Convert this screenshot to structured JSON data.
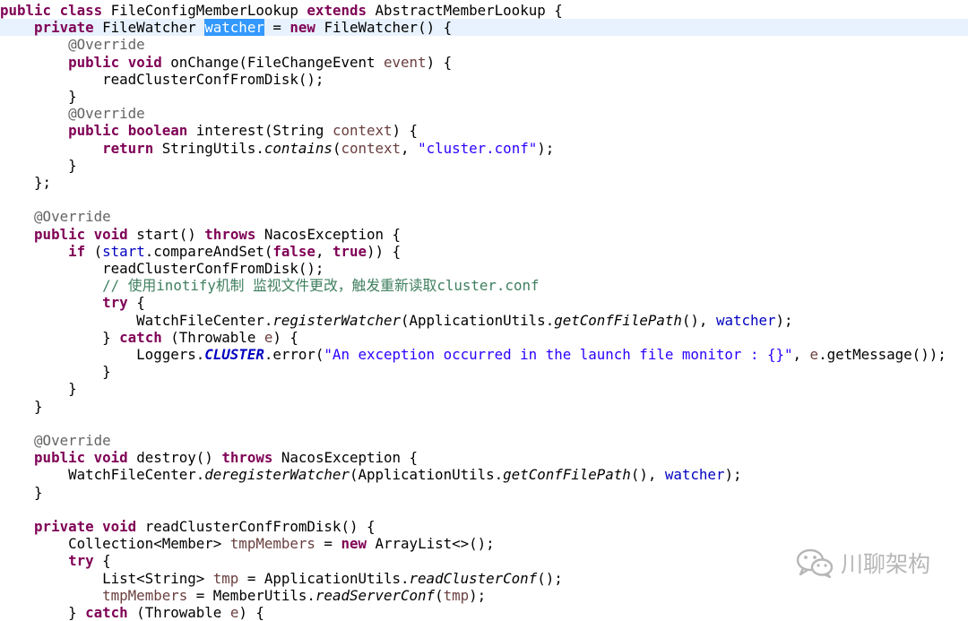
{
  "editor": {
    "lines": [
      [
        {
          "t": "public",
          "c": "kw"
        },
        {
          "t": " "
        },
        {
          "t": "class",
          "c": "kw"
        },
        {
          "t": " FileConfigMemberLookup "
        },
        {
          "t": "extends",
          "c": "kw"
        },
        {
          "t": " AbstractMemberLookup {"
        }
      ],
      [
        {
          "t": "    "
        },
        {
          "t": "private",
          "c": "kw"
        },
        {
          "t": " FileWatcher "
        },
        {
          "t": "watcher",
          "c": "sel"
        },
        {
          "t": " = "
        },
        {
          "t": "new",
          "c": "kw"
        },
        {
          "t": " FileWatcher() {"
        }
      ],
      [
        {
          "t": "        "
        },
        {
          "t": "@Override",
          "c": "ann"
        }
      ],
      [
        {
          "t": "        "
        },
        {
          "t": "public",
          "c": "kw"
        },
        {
          "t": " "
        },
        {
          "t": "void",
          "c": "kw"
        },
        {
          "t": " onChange(FileChangeEvent "
        },
        {
          "t": "event",
          "c": "var"
        },
        {
          "t": ") {"
        }
      ],
      [
        {
          "t": "            readClusterConfFromDisk();"
        }
      ],
      [
        {
          "t": "        }"
        }
      ],
      [
        {
          "t": "        "
        },
        {
          "t": "@Override",
          "c": "ann"
        }
      ],
      [
        {
          "t": "        "
        },
        {
          "t": "public",
          "c": "kw"
        },
        {
          "t": " "
        },
        {
          "t": "boolean",
          "c": "kw"
        },
        {
          "t": " interest(String "
        },
        {
          "t": "context",
          "c": "var"
        },
        {
          "t": ") {"
        }
      ],
      [
        {
          "t": "            "
        },
        {
          "t": "return",
          "c": "kw"
        },
        {
          "t": " StringUtils."
        },
        {
          "t": "contains",
          "c": "ital"
        },
        {
          "t": "("
        },
        {
          "t": "context",
          "c": "var"
        },
        {
          "t": ", "
        },
        {
          "t": "\"cluster.conf\"",
          "c": "str"
        },
        {
          "t": ");"
        }
      ],
      [
        {
          "t": "        }"
        }
      ],
      [
        {
          "t": "    };"
        }
      ],
      [],
      [
        {
          "t": "    "
        },
        {
          "t": "@Override",
          "c": "ann"
        }
      ],
      [
        {
          "t": "    "
        },
        {
          "t": "public",
          "c": "kw"
        },
        {
          "t": " "
        },
        {
          "t": "void",
          "c": "kw"
        },
        {
          "t": " start() "
        },
        {
          "t": "throws",
          "c": "kw"
        },
        {
          "t": " NacosException {"
        }
      ],
      [
        {
          "t": "        "
        },
        {
          "t": "if",
          "c": "kw"
        },
        {
          "t": " ("
        },
        {
          "t": "start",
          "c": "fld"
        },
        {
          "t": ".compareAndSet("
        },
        {
          "t": "false",
          "c": "kw"
        },
        {
          "t": ", "
        },
        {
          "t": "true",
          "c": "kw"
        },
        {
          "t": ")) {"
        }
      ],
      [
        {
          "t": "            readClusterConfFromDisk();"
        }
      ],
      [
        {
          "t": "            "
        },
        {
          "t": "// ",
          "c": "cmt"
        },
        {
          "t": "使用",
          "c": "cmt cjk"
        },
        {
          "t": "inotify",
          "c": "cmt sq"
        },
        {
          "t": "机制 监视文件更改，触发重新读取",
          "c": "cmt cjk"
        },
        {
          "t": "cluster.conf",
          "c": "cmt"
        }
      ],
      [
        {
          "t": "            "
        },
        {
          "t": "try",
          "c": "kw"
        },
        {
          "t": " {"
        }
      ],
      [
        {
          "t": "                WatchFileCenter."
        },
        {
          "t": "registerWatcher",
          "c": "ital"
        },
        {
          "t": "(ApplicationUtils."
        },
        {
          "t": "getConfFilePath",
          "c": "ital"
        },
        {
          "t": "(), "
        },
        {
          "t": "watcher",
          "c": "fld"
        },
        {
          "t": ");"
        }
      ],
      [
        {
          "t": "            } "
        },
        {
          "t": "catch",
          "c": "kw"
        },
        {
          "t": " (Throwable "
        },
        {
          "t": "e",
          "c": "var"
        },
        {
          "t": ") {"
        }
      ],
      [
        {
          "t": "                Loggers."
        },
        {
          "t": "CLUSTER",
          "c": "sfld"
        },
        {
          "t": ".error("
        },
        {
          "t": "\"An exception occurred in the launch file monitor : {}\"",
          "c": "str"
        },
        {
          "t": ", "
        },
        {
          "t": "e",
          "c": "var"
        },
        {
          "t": ".getMessage());"
        }
      ],
      [
        {
          "t": "            }"
        }
      ],
      [
        {
          "t": "        }"
        }
      ],
      [
        {
          "t": "    }"
        }
      ],
      [],
      [
        {
          "t": "    "
        },
        {
          "t": "@Override",
          "c": "ann"
        }
      ],
      [
        {
          "t": "    "
        },
        {
          "t": "public",
          "c": "kw"
        },
        {
          "t": " "
        },
        {
          "t": "void",
          "c": "kw"
        },
        {
          "t": " destroy() "
        },
        {
          "t": "throws",
          "c": "kw"
        },
        {
          "t": " NacosException {"
        }
      ],
      [
        {
          "t": "        WatchFileCenter."
        },
        {
          "t": "deregisterWatcher",
          "c": "ital"
        },
        {
          "t": "(ApplicationUtils."
        },
        {
          "t": "getConfFilePath",
          "c": "ital"
        },
        {
          "t": "(), "
        },
        {
          "t": "watcher",
          "c": "fld"
        },
        {
          "t": ");"
        }
      ],
      [
        {
          "t": "    }"
        }
      ],
      [],
      [
        {
          "t": "    "
        },
        {
          "t": "private",
          "c": "kw"
        },
        {
          "t": " "
        },
        {
          "t": "void",
          "c": "kw"
        },
        {
          "t": " readClusterConfFromDisk() {"
        }
      ],
      [
        {
          "t": "        Collection<Member> "
        },
        {
          "t": "tmpMembers",
          "c": "var"
        },
        {
          "t": " = "
        },
        {
          "t": "new",
          "c": "kw"
        },
        {
          "t": " ArrayList<>();"
        }
      ],
      [
        {
          "t": "        "
        },
        {
          "t": "try",
          "c": "kw"
        },
        {
          "t": " {"
        }
      ],
      [
        {
          "t": "            List<String> "
        },
        {
          "t": "tmp",
          "c": "var"
        },
        {
          "t": " = ApplicationUtils."
        },
        {
          "t": "readClusterConf",
          "c": "ital"
        },
        {
          "t": "();"
        }
      ],
      [
        {
          "t": "            "
        },
        {
          "t": "tmpMembers",
          "c": "var"
        },
        {
          "t": " = MemberUtils."
        },
        {
          "t": "readServerConf",
          "c": "ital"
        },
        {
          "t": "("
        },
        {
          "t": "tmp",
          "c": "var"
        },
        {
          "t": ");"
        }
      ],
      [
        {
          "t": "        } "
        },
        {
          "t": "catch",
          "c": "kw"
        },
        {
          "t": " (Throwable "
        },
        {
          "t": "e",
          "c": "var"
        },
        {
          "t": ") {"
        }
      ]
    ],
    "current_line": 1
  },
  "watermark": {
    "text": "川聊架构",
    "icon": "wechat-icon"
  }
}
